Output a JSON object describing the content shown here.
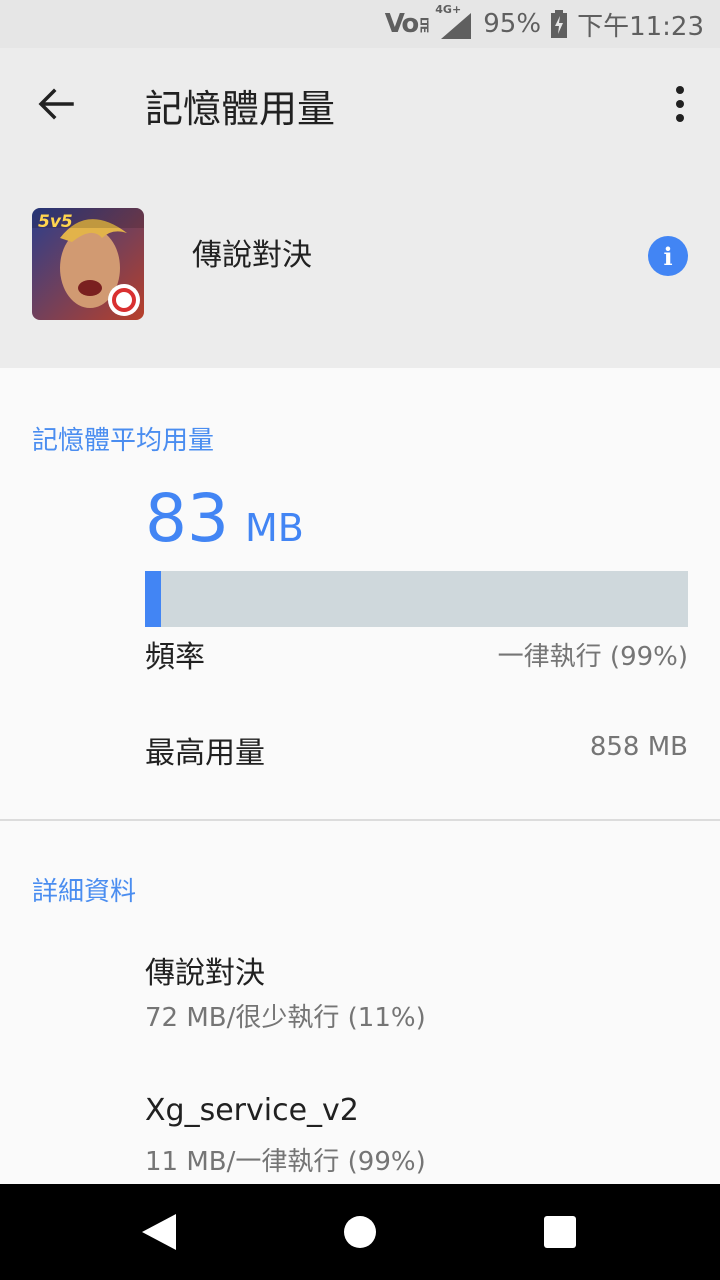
{
  "status_bar": {
    "volte": "Vo",
    "volte_sub": "LTE",
    "network": "4G+",
    "battery": "95%",
    "time": "下午11:23"
  },
  "app_bar": {
    "title": "記憶體用量"
  },
  "app": {
    "name": "傳說對決",
    "icon_badge": "5v5"
  },
  "avg_section": {
    "title": "記憶體平均用量",
    "value": "83",
    "unit": "MB",
    "bar_fraction": 0.03
  },
  "frequency": {
    "label": "頻率",
    "value": "一律執行 (99%)"
  },
  "max_usage": {
    "label": "最高用量",
    "value": "858 MB"
  },
  "details": {
    "title": "詳細資料",
    "items": [
      {
        "name": "傳說對決",
        "detail": "72 MB/很少執行 (11%)"
      },
      {
        "name": "Xg_service_v2",
        "detail": "11 MB/一律執行 (99%)"
      }
    ]
  },
  "colors": {
    "accent": "#4285f4",
    "bar_track": "#cfd8dc"
  }
}
